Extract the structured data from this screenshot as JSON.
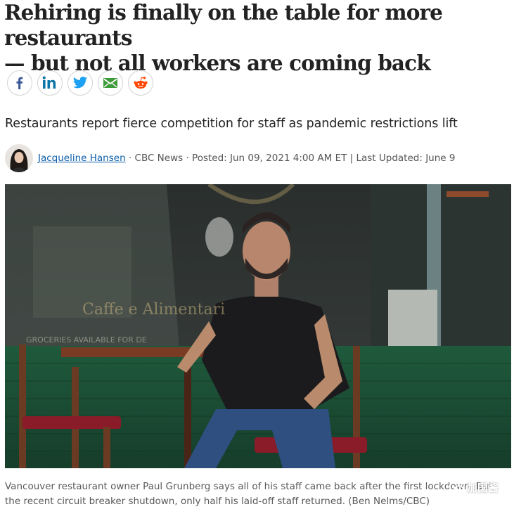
{
  "article": {
    "headline_line1": "Rehiring is finally on the table for more restaurants",
    "headline_line2": "— but not all workers are coming back",
    "deck": "Restaurants report fierce competition for staff as pandemic restrictions lift",
    "byline": {
      "author": "Jacqueline Hansen",
      "rest": " · CBC News · Posted: Jun 09, 2021 4:00 AM ET | Last Updated: June 9"
    },
    "photo": {
      "sign_text_1": "Caffe e Alimentari",
      "sign_text_2": "GROCERIES AVAILABLE FOR DE"
    },
    "caption_line1": "Vancouver restaurant owner Paul Grunberg says all of his staff came back after the first lockdown. But",
    "caption_line2": "the recent circuit breaker shutdown, only half his laid-off staff returned. (Ben Nelms/CBC)"
  },
  "share": {
    "buttons": [
      {
        "name": "facebook",
        "icon": "facebook-icon",
        "color": "#3b5998"
      },
      {
        "name": "linkedin",
        "icon": "linkedin-icon",
        "color": "#0e76a8"
      },
      {
        "name": "twitter",
        "icon": "twitter-icon",
        "color": "#1da1f2"
      },
      {
        "name": "email",
        "icon": "email-icon",
        "color": "#3e9b3a"
      },
      {
        "name": "reddit",
        "icon": "reddit-icon",
        "color": "#ff4500"
      }
    ]
  },
  "watermark": {
    "text": "加国酱",
    "icon": "wechat-icon"
  }
}
